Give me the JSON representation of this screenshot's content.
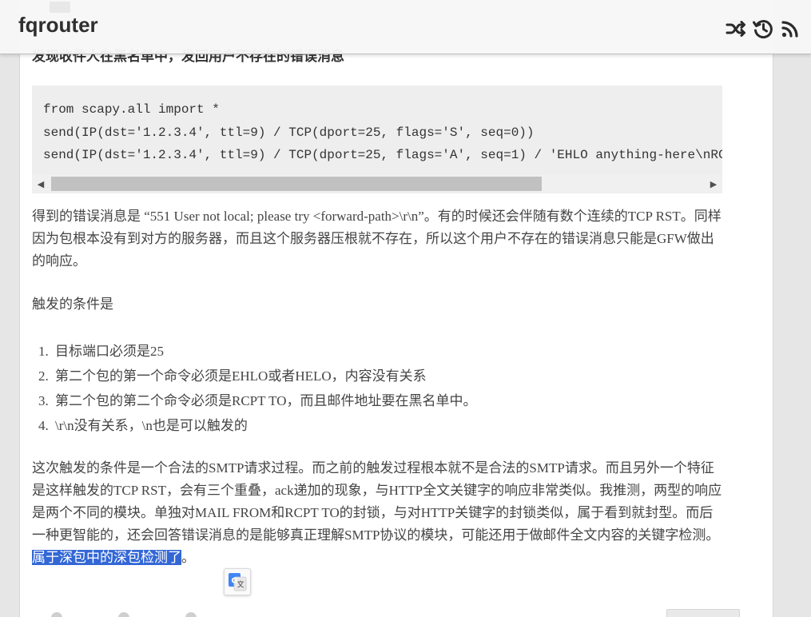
{
  "header": {
    "site_title": "fqrouter",
    "icons": [
      "shuffle-icon",
      "history-icon",
      "rss-icon"
    ]
  },
  "article": {
    "cut_heading": "发现收件人在黑名单中，发回用户不存在的错误消息",
    "code_lines": [
      "from scapy.all import *",
      "send(IP(dst='1.2.3.4', ttl=9) / TCP(dport=25, flags='S', seq=0))",
      "send(IP(dst='1.2.3.4', ttl=9) / TCP(dport=25, flags='A', seq=1) / 'EHLO anything-here\\nRC"
    ],
    "para_error": "得到的错误消息是 “551 User not local; please try <forward-path>\\r\\n”。有的时候还会伴随有数个连续的TCP RST。同样因为包根本没有到对方的服务器，而且这个服务器压根就不存在，所以这个用户不存在的错误消息只能是GFW做出的响应。",
    "para_trigger_heading": "触发的条件是",
    "conditions": [
      {
        "num": "1.",
        "text": "目标端口必须是25"
      },
      {
        "num": "2.",
        "text": "第二个包的第一个命令必须是EHLO或者HELO，内容没有关系"
      },
      {
        "num": "3.",
        "text": "第二个包的第二个命令必须是RCPT TO，而且邮件地址要在黑名单中。"
      },
      {
        "num": "4.",
        "text": "\\r\\n没有关系，\\n也是可以触发的"
      }
    ],
    "para_summary": "这次触发的条件是一个合法的SMTP请求过程。而之前的触发过程根本就不是合法的SMTP请求。而且另外一个特征是这样触发的TCP RST，会有三个重叠，ack递加的现象，与HTTP全文关键字的响应非常类似。我推测，两型的响应是两个不同的模块。单独对MAIL FROM和RCPT TO的封锁，与对HTTP关键字的封锁类似，属于看到就封型。而后一种更智能的，还会回答错误消息的是能够真正理解SMTP协议的模块，可能还用于做邮件全文内容的关键字检测。",
    "para_summary_selected": "属于深包中的深包检测了",
    "para_summary_end": "。"
  },
  "colors": {
    "selection": "#3367d6",
    "code_bg": "#eeeeee",
    "topbar_bg": "#f7f7f7"
  }
}
